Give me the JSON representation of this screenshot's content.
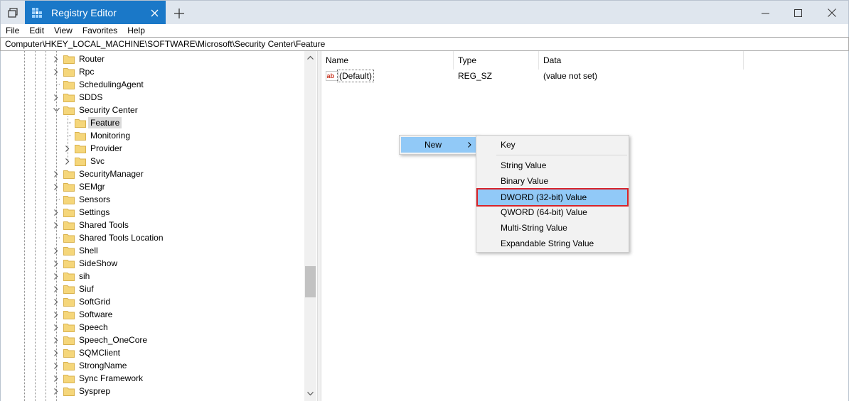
{
  "window": {
    "title": "Registry Editor",
    "controls": {
      "minimize": "minimize-icon",
      "maximize": "maximize-icon",
      "close": "close-icon"
    }
  },
  "menu": [
    "File",
    "Edit",
    "View",
    "Favorites",
    "Help"
  ],
  "address": "Computer\\HKEY_LOCAL_MACHINE\\SOFTWARE\\Microsoft\\Security Center\\Feature",
  "tree": {
    "items": [
      {
        "label": "Router",
        "expandable": true
      },
      {
        "label": "Rpc",
        "expandable": true
      },
      {
        "label": "SchedulingAgent",
        "expandable": false
      },
      {
        "label": "SDDS",
        "expandable": true
      },
      {
        "label": "Security Center",
        "expandable": true,
        "expanded": true
      },
      {
        "label": "Feature",
        "expandable": false,
        "selected": true,
        "child": true
      },
      {
        "label": "Monitoring",
        "expandable": false,
        "child": true
      },
      {
        "label": "Provider",
        "expandable": true,
        "child": true
      },
      {
        "label": "Svc",
        "expandable": true,
        "child": true
      },
      {
        "label": "SecurityManager",
        "expandable": true
      },
      {
        "label": "SEMgr",
        "expandable": true
      },
      {
        "label": "Sensors",
        "expandable": false
      },
      {
        "label": "Settings",
        "expandable": true
      },
      {
        "label": "Shared Tools",
        "expandable": true
      },
      {
        "label": "Shared Tools Location",
        "expandable": false
      },
      {
        "label": "Shell",
        "expandable": true
      },
      {
        "label": "SideShow",
        "expandable": true
      },
      {
        "label": "sih",
        "expandable": true
      },
      {
        "label": "Siuf",
        "expandable": true
      },
      {
        "label": "SoftGrid",
        "expandable": true
      },
      {
        "label": "Software",
        "expandable": true
      },
      {
        "label": "Speech",
        "expandable": true
      },
      {
        "label": "Speech_OneCore",
        "expandable": true
      },
      {
        "label": "SQMClient",
        "expandable": true
      },
      {
        "label": "StrongName",
        "expandable": true
      },
      {
        "label": "Sync Framework",
        "expandable": true
      },
      {
        "label": "Sysprep",
        "expandable": true
      }
    ]
  },
  "list": {
    "columns": [
      "Name",
      "Type",
      "Data"
    ],
    "rows": [
      {
        "name": "(Default)",
        "type": "REG_SZ",
        "data": "(value not set)",
        "icon": "string-value-icon"
      }
    ]
  },
  "context_menu": {
    "new_label": "New",
    "submenu": {
      "key": "Key",
      "items": [
        "String Value",
        "Binary Value",
        "DWORD (32-bit) Value",
        "QWORD (64-bit) Value",
        "Multi-String Value",
        "Expandable String Value"
      ],
      "highlighted": "DWORD (32-bit) Value"
    }
  },
  "colors": {
    "title_tab": "#1a78c8",
    "menu_highlight": "#91c9f7",
    "annotation_box": "#d8232a",
    "folder": "#f5d67a"
  }
}
